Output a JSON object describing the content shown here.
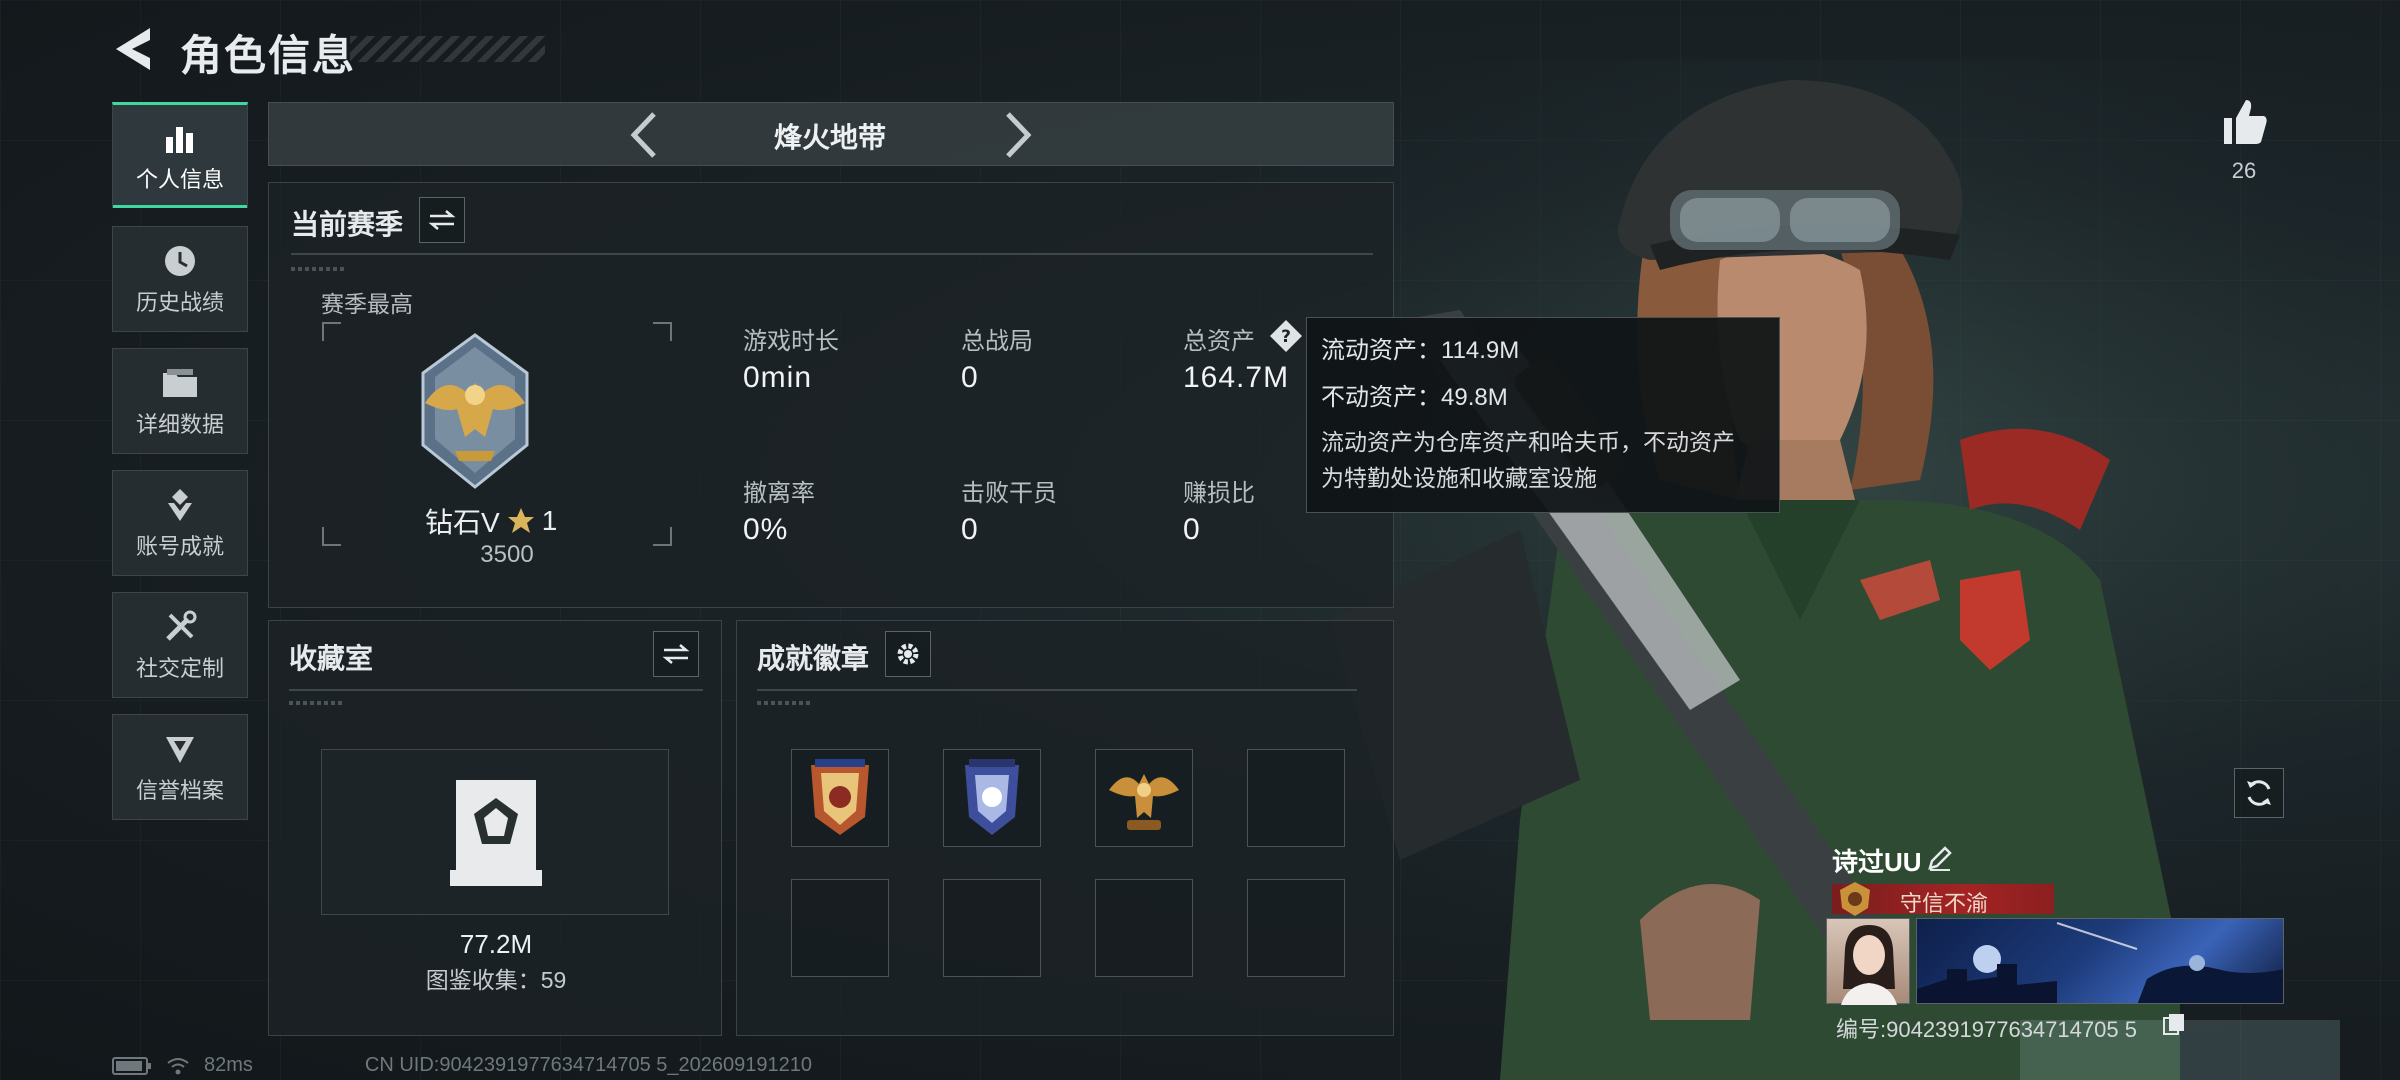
{
  "header": {
    "title": "角色信息"
  },
  "sidebar": {
    "items": [
      {
        "label": "个人信息",
        "icon": "bar-chart-icon",
        "active": true
      },
      {
        "label": "历史战绩",
        "icon": "history-clock-icon",
        "active": false
      },
      {
        "label": "详细数据",
        "icon": "folder-icon",
        "active": false
      },
      {
        "label": "账号成就",
        "icon": "achievement-medal-icon",
        "active": false
      },
      {
        "label": "社交定制",
        "icon": "tools-icon",
        "active": false
      },
      {
        "label": "信誉档案",
        "icon": "shield-badge-icon",
        "active": false
      }
    ]
  },
  "mode": {
    "name": "烽火地带"
  },
  "season": {
    "title": "当前赛季",
    "best_label": "赛季最高",
    "rank_name": "钻石V",
    "rank_stars": "1",
    "rank_score": "3500",
    "stats": [
      {
        "label": "游戏时长",
        "value": "0min"
      },
      {
        "label": "总战局",
        "value": "0"
      },
      {
        "label": "总资产",
        "value": "164.7M"
      },
      {
        "label": "撤离率",
        "value": "0%"
      },
      {
        "label": "击败干员",
        "value": "0"
      },
      {
        "label": "赚损比",
        "value": "0"
      }
    ]
  },
  "tooltip": {
    "liquid": "流动资产：114.9M",
    "fixed": "不动资产：49.8M",
    "desc1": "流动资产为仓库资产和哈夫币，不动资产",
    "desc2": "为特勤处设施和收藏室设施"
  },
  "collection": {
    "title": "收藏室",
    "value": "77.2M",
    "count_text": "图鉴收集：59"
  },
  "badges": {
    "title": "成就徽章",
    "slots": [
      {
        "icon": "red-shield-badge-icon",
        "filled": true
      },
      {
        "icon": "blue-shield-badge-icon",
        "filled": true
      },
      {
        "icon": "gold-eagle-badge-icon",
        "filled": true
      },
      {
        "icon": "",
        "filled": false
      },
      {
        "icon": "",
        "filled": false
      },
      {
        "icon": "",
        "filled": false
      },
      {
        "icon": "",
        "filled": false
      },
      {
        "icon": "",
        "filled": false
      }
    ]
  },
  "status": {
    "ping": "82ms",
    "uid": "CN UID:9042391977634714705 5_202609191210"
  },
  "player": {
    "likes": "26",
    "name": "诗过UU",
    "title": "守信不渝",
    "id_text": "编号:9042391977634714705 5"
  },
  "colors": {
    "accent": "#3fd9a0",
    "title_red": "#a32424",
    "panel_bg": "#1c2327"
  }
}
